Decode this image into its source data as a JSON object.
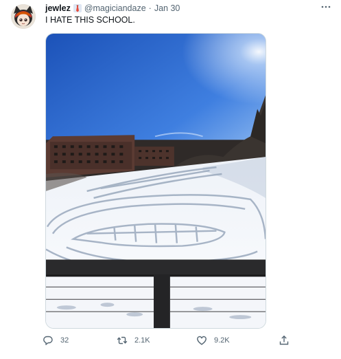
{
  "author": {
    "display_name": "jewlez",
    "handle": "@magiciandaze",
    "separator": "·",
    "date": "Jan 30",
    "badge_icon": "red-tie-emoji-icon"
  },
  "tweet": {
    "text": "I HATE THIS SCHOOL."
  },
  "more_icon": "more-dots-icon",
  "actions": {
    "reply_count": "32",
    "retweet_count": "2.1K",
    "like_count": "9.2K"
  },
  "colors": {
    "muted_text": "#536471",
    "primary_text": "#0f1419",
    "border": "#cfd9de"
  }
}
